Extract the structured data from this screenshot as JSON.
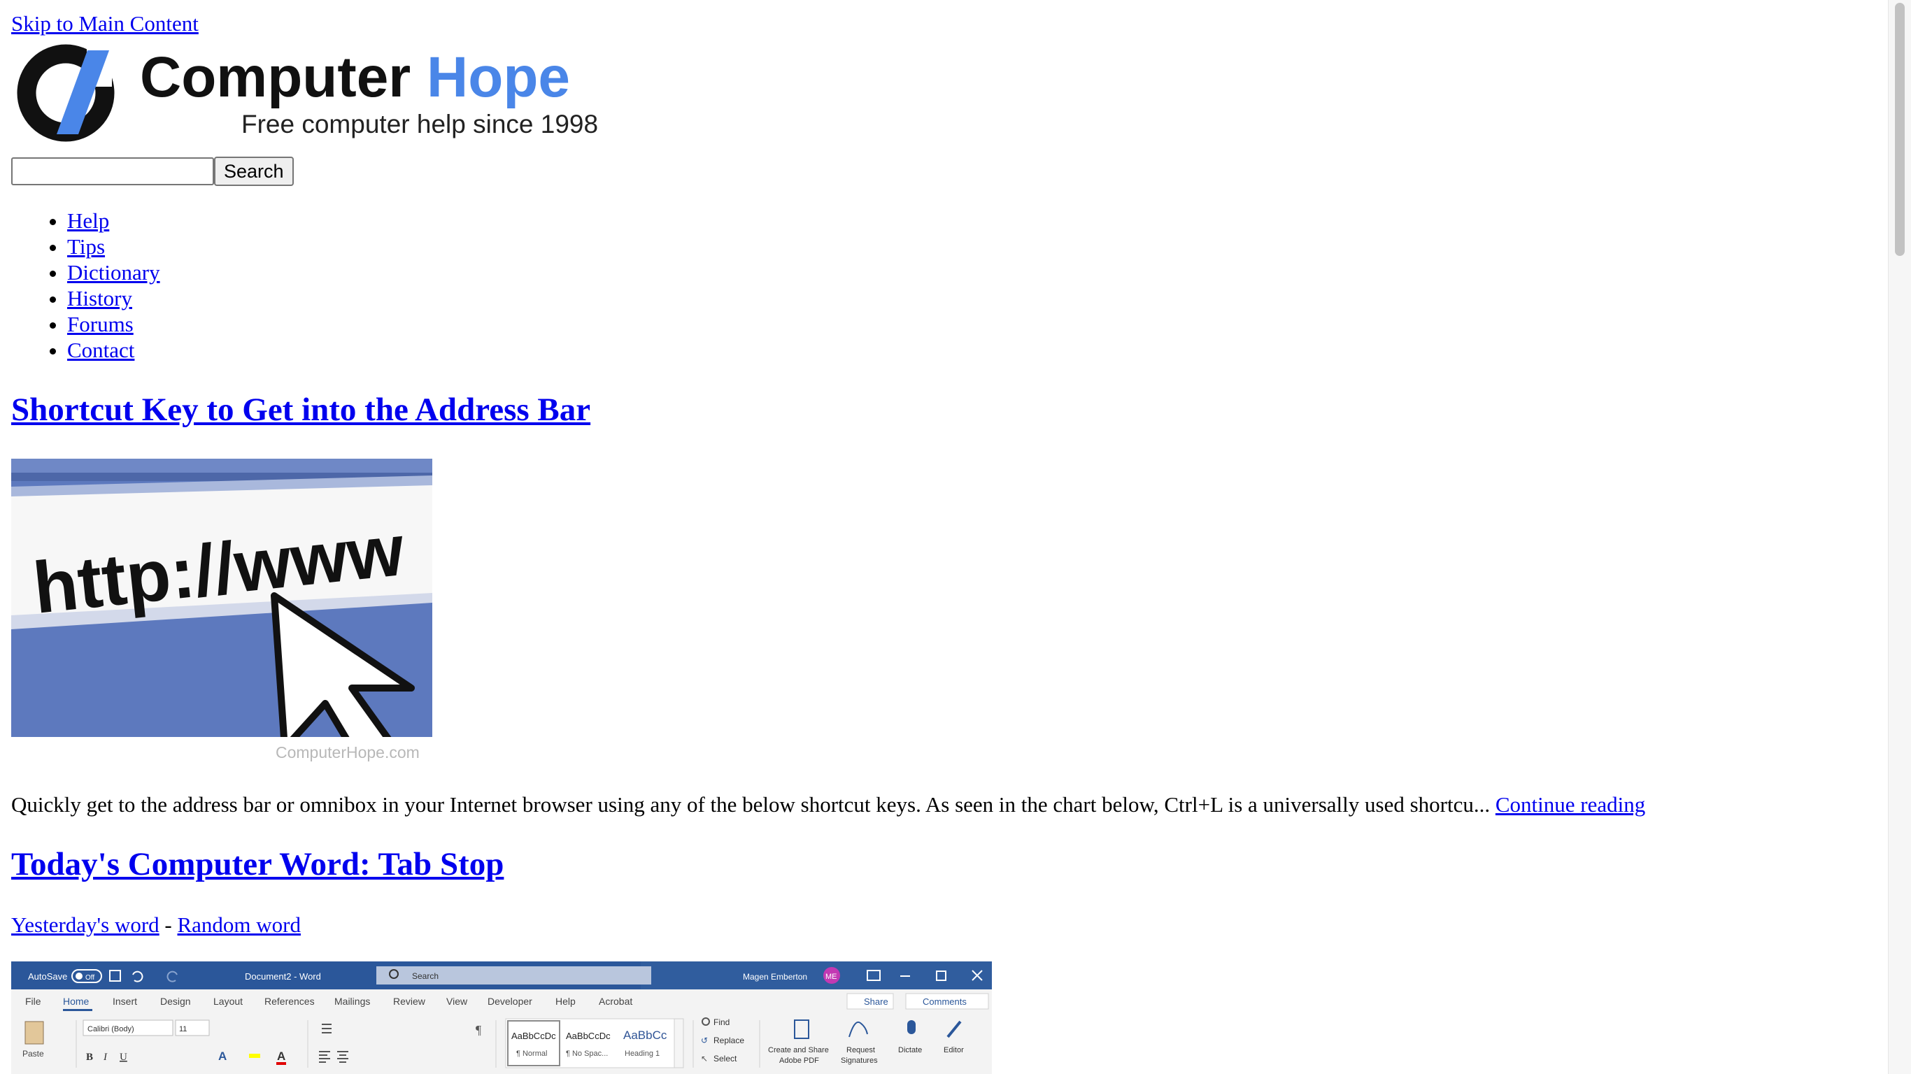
{
  "skip_link": "Skip to Main Content",
  "logo": {
    "name_part1": "Computer",
    "name_part2": "Hope",
    "tagline": "Free computer help since 1998",
    "colors": {
      "brand_blue": "#4a86e8",
      "brand_dark": "#111111"
    }
  },
  "search": {
    "input_value": "",
    "placeholder": "",
    "button_label": "Search"
  },
  "nav": {
    "items": [
      {
        "label": "Help"
      },
      {
        "label": "Tips"
      },
      {
        "label": "Dictionary"
      },
      {
        "label": "History"
      },
      {
        "label": "Forums"
      },
      {
        "label": "Contact"
      }
    ]
  },
  "article": {
    "title": "Shortcut Key to Get into the Address Bar",
    "image": {
      "url_text": "http://www",
      "watermark": "ComputerHope.com"
    },
    "summary": "Quickly get to the address bar or omnibox in your Internet browser using any of the below shortcut keys. As seen in the chart below, Ctrl+L is a universally used shortcu...",
    "continue_label": "Continue reading"
  },
  "word_of_day": {
    "title": "Today's Computer Word: Tab Stop",
    "yesterday_label": "Yesterday's word",
    "separator": " - ",
    "random_label": "Random word",
    "screenshot": {
      "autosave": "AutoSave",
      "autosave_state": "Off",
      "doc_title": "Document2 - Word",
      "search": "Search",
      "user": "Magen Emberton",
      "user_initials": "ME",
      "share": "Share",
      "comments": "Comments",
      "tabs": [
        "File",
        "Home",
        "Insert",
        "Design",
        "Layout",
        "References",
        "Mailings",
        "Review",
        "View",
        "Developer",
        "Help",
        "Acrobat"
      ],
      "font": "Calibri (Body)",
      "font_size": "11",
      "paste": "Paste",
      "styles": [
        {
          "sample": "AaBbCcDc",
          "name": "¶ Normal"
        },
        {
          "sample": "AaBbCcDc",
          "name": "¶ No Spac..."
        },
        {
          "sample": "AaBbCc",
          "name": "Heading 1"
        }
      ],
      "editing": [
        "Find",
        "Replace",
        "Select"
      ],
      "tools": [
        {
          "line1": "Create and Share",
          "line2": "Adobe PDF"
        },
        {
          "line1": "Request",
          "line2": "Signatures"
        },
        {
          "line1": "Dictate",
          "line2": ""
        },
        {
          "line1": "Editor",
          "line2": ""
        }
      ]
    }
  }
}
